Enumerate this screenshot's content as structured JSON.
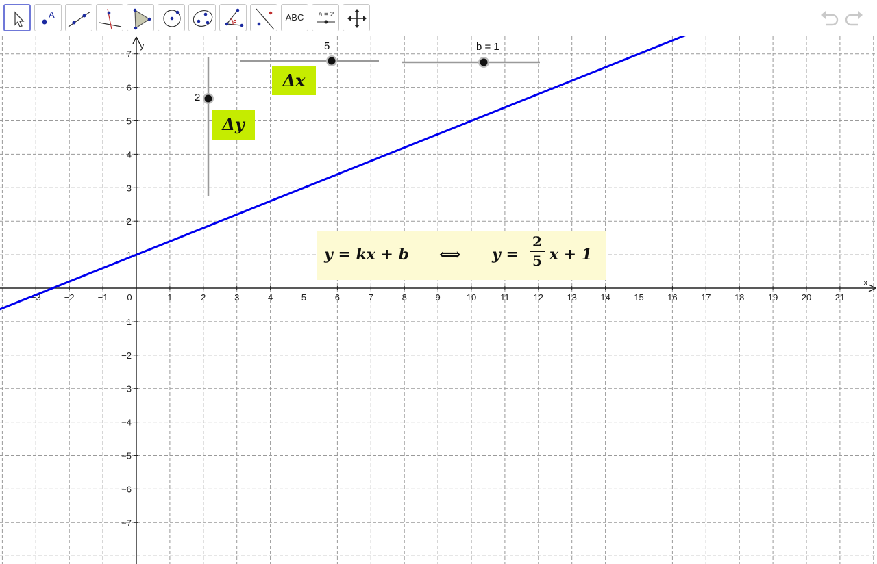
{
  "toolbar": {
    "tools": [
      {
        "name": "move-tool",
        "icon": "cursor-arrow-icon"
      },
      {
        "name": "point-tool",
        "icon": "point-with-label-icon",
        "label": "A"
      },
      {
        "name": "line-tool",
        "icon": "line-through-two-points-icon"
      },
      {
        "name": "perpendicular-tool",
        "icon": "perpendicular-line-icon"
      },
      {
        "name": "polygon-tool",
        "icon": "polygon-icon"
      },
      {
        "name": "circle-tool",
        "icon": "circle-center-point-icon"
      },
      {
        "name": "conic-tool",
        "icon": "ellipse-icon"
      },
      {
        "name": "angle-tool",
        "icon": "angle-icon"
      },
      {
        "name": "reflect-tool",
        "icon": "reflect-about-line-icon"
      },
      {
        "name": "text-tool",
        "icon": "text-icon",
        "label": "ABC"
      },
      {
        "name": "slider-tool",
        "icon": "slider-icon",
        "label": "a = 2"
      },
      {
        "name": "move-graphics-view-tool",
        "icon": "move-arrows-icon"
      }
    ],
    "undo_icon": "undo-icon",
    "redo_icon": "redo-icon"
  },
  "graph": {
    "x_axis_label": "x",
    "y_axis_label": "y",
    "x_ticks": [
      "−3",
      "−2",
      "−1",
      "0",
      "1",
      "2",
      "3",
      "4",
      "5",
      "6",
      "7",
      "8",
      "9",
      "10",
      "11",
      "12",
      "13",
      "14",
      "15",
      "16",
      "17",
      "18",
      "19",
      "20",
      "21"
    ],
    "y_ticks_pos": [
      "1",
      "2",
      "3",
      "4",
      "5",
      "6",
      "7"
    ],
    "y_ticks_neg": [
      "−1",
      "−2",
      "−3",
      "−4",
      "−5",
      "−6",
      "−7"
    ],
    "line": {
      "k": 0.4,
      "b": 1,
      "color": "#0000ee"
    },
    "grid": true
  },
  "sliders": {
    "dx": {
      "label": "5",
      "value": 5
    },
    "dy": {
      "label": "2",
      "value": 2
    },
    "b": {
      "label": "b = 1",
      "value": 1
    }
  },
  "labels": {
    "delta_x": "Δx",
    "delta_y": "Δy"
  },
  "formula": {
    "left": "y = kx + b",
    "arrow": "⟺",
    "y_eq": "y =",
    "numerator": "2",
    "denominator": "5",
    "rest": "x + 1"
  }
}
